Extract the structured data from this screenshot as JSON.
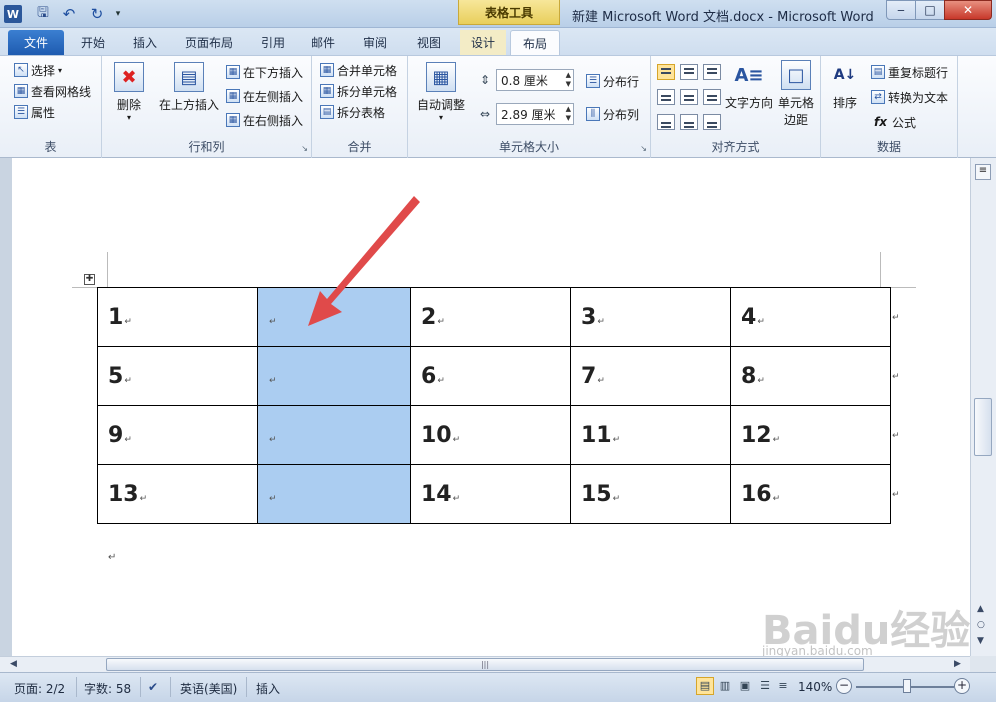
{
  "titlebar": {
    "app_logo": "W",
    "contextual_tab_group": "表格工具",
    "window_title": "新建 Microsoft Word 文档.docx  -  Microsoft Word"
  },
  "tabs": {
    "file": "文件",
    "home": "开始",
    "insert": "插入",
    "page_layout": "页面布局",
    "references": "引用",
    "mailings": "邮件",
    "review": "审阅",
    "view": "视图",
    "design": "设计",
    "layout": "布局"
  },
  "ribbon": {
    "table_group": {
      "label": "表",
      "select": "选择",
      "view_gridlines": "查看网格线",
      "properties": "属性"
    },
    "rows_cols_group": {
      "label": "行和列",
      "delete": "删除",
      "insert_above": "在上方插入",
      "insert_below": "在下方插入",
      "insert_left": "在左侧插入",
      "insert_right": "在右侧插入"
    },
    "merge_group": {
      "label": "合并",
      "merge_cells": "合并单元格",
      "split_cells": "拆分单元格",
      "split_table": "拆分表格"
    },
    "cell_size_group": {
      "label": "单元格大小",
      "autofit": "自动调整",
      "row_height": "0.8 厘米",
      "col_width": "2.89 厘米",
      "distribute_rows": "分布行",
      "distribute_cols": "分布列"
    },
    "alignment_group": {
      "label": "对齐方式",
      "text_direction": "文字方向",
      "cell_margins_1": "单元格",
      "cell_margins_2": "边距"
    },
    "data_group": {
      "label": "数据",
      "sort": "排序",
      "repeat_header": "重复标题行",
      "convert_to_text": "转换为文本",
      "formula": "公式"
    }
  },
  "document": {
    "table_rows": [
      [
        "1",
        "",
        "2",
        "3",
        "4"
      ],
      [
        "5",
        "",
        "6",
        "7",
        "8"
      ],
      [
        "9",
        "",
        "10",
        "11",
        "12"
      ],
      [
        "13",
        "",
        "14",
        "15",
        "16"
      ]
    ],
    "selected_column": 1,
    "cell_mark": "↵"
  },
  "watermark": {
    "brand": "Baidu经验",
    "url": "jingyan.baidu.com"
  },
  "statusbar": {
    "page": "页面: 2/2",
    "words": "字数: 58",
    "language": "英语(美国)",
    "insert_mode": "插入",
    "zoom": "140%"
  },
  "colors": {
    "selection": "#abcdf1",
    "arrow": "#e04a4a",
    "file_tab": "#1e5bb0",
    "contextual": "#e8cf5c"
  },
  "icons": [
    "word-logo-icon",
    "save-icon",
    "undo-icon",
    "redo-icon",
    "help-icon",
    "delete-icon",
    "insert-above-icon",
    "autofit-icon",
    "text-direction-icon",
    "cell-margins-icon",
    "sort-icon",
    "formula-icon"
  ]
}
